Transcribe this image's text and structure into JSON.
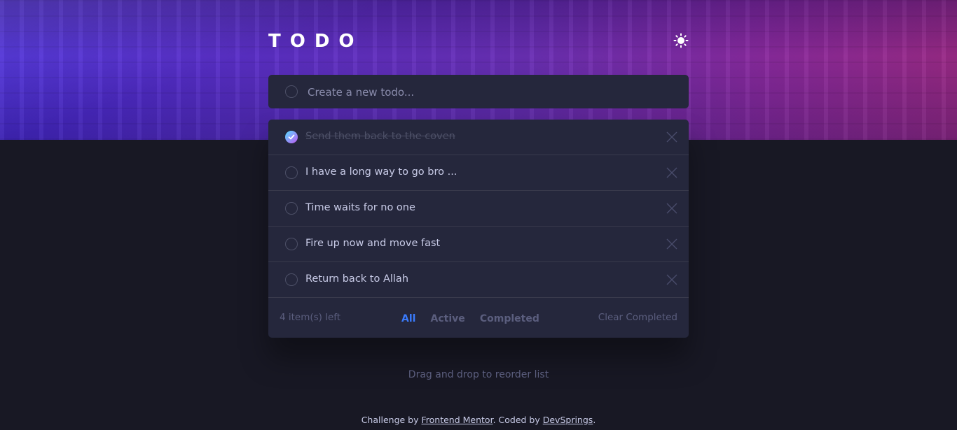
{
  "header": {
    "title": "TODO",
    "theme_icon": "sun-icon"
  },
  "new_todo": {
    "placeholder": "Create a new todo..."
  },
  "todos": [
    {
      "text": "Send them back to the coven",
      "completed": true
    },
    {
      "text": "I have a long way to go bro ...",
      "completed": false
    },
    {
      "text": "Time waits for no one",
      "completed": false
    },
    {
      "text": "Fire up now and move fast",
      "completed": false
    },
    {
      "text": "Return back to Allah",
      "completed": false
    }
  ],
  "footer": {
    "items_left": "4 item(s) left",
    "filters": [
      "All",
      "Active",
      "Completed"
    ],
    "active_filter": "All",
    "clear_label": "Clear Completed"
  },
  "hint": "Drag and drop to reorder list",
  "attribution": {
    "prefix": "Challenge by ",
    "link1": "Frontend Mentor",
    "middle": ". Coded by ",
    "link2": "DevSprings",
    "suffix": "."
  },
  "colors": {
    "accent": "#3a7bfd",
    "card_bg": "#25273c",
    "page_bg": "#181824",
    "check_gradient_start": "#55ddff",
    "check_gradient_end": "#c058f3"
  }
}
